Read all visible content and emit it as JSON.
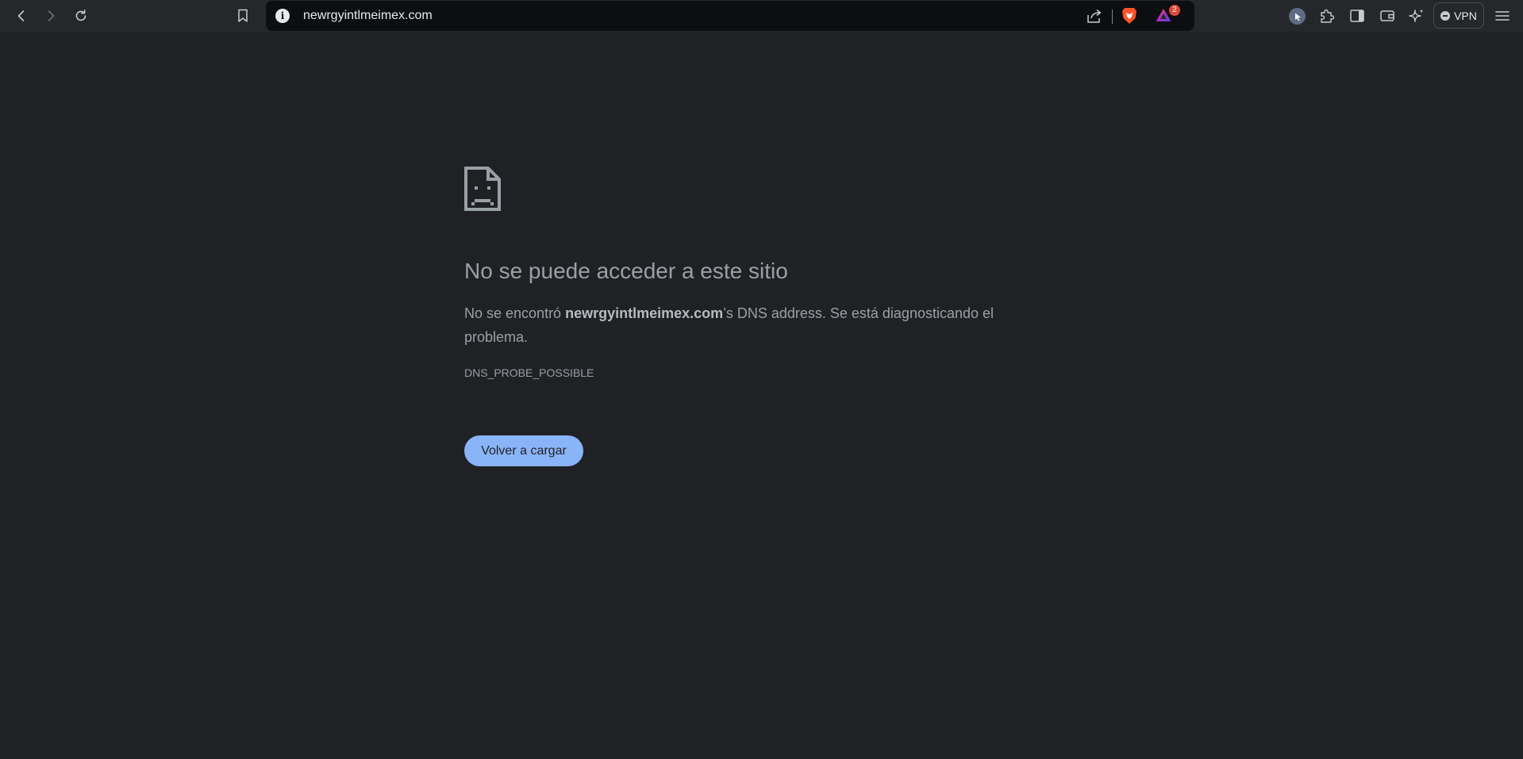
{
  "browser": {
    "url": "newrgyintlmeimex.com",
    "rewards_badge_count": "2",
    "vpn_label": "VPN"
  },
  "error_page": {
    "title": "No se puede acceder a este sitio",
    "description_prefix": "No se encontró ",
    "description_host": "newrgyintlmeimex.com",
    "description_suffix": "’s DNS address. Se está diagnosticando el problema.",
    "error_code": "DNS_PROBE_POSSIBLE",
    "reload_button_label": "Volver a cargar"
  },
  "colors": {
    "page_background": "#202124",
    "toolbar_background": "#25272b",
    "omnibox_background": "#0d0e11",
    "text_muted": "#9aa0a6",
    "reload_button": "#8ab4f8",
    "brave_orange": "#fb542b",
    "rewards_badge": "#e0453a"
  },
  "icons": {
    "back": "back-arrow-icon",
    "forward": "forward-arrow-icon",
    "reload": "reload-icon",
    "bookmark": "bookmark-icon",
    "site_info": "info-icon",
    "share": "share-icon",
    "brave_shields": "brave-lion-icon",
    "brave_rewards": "rewards-triangle-icon",
    "profile": "cursor-profile-icon",
    "extensions": "puzzle-icon",
    "sidebar": "sidebar-icon",
    "wallet": "wallet-icon",
    "leo_ai": "sparkle-icon",
    "menu": "hamburger-menu-icon",
    "error": "sad-document-icon"
  }
}
